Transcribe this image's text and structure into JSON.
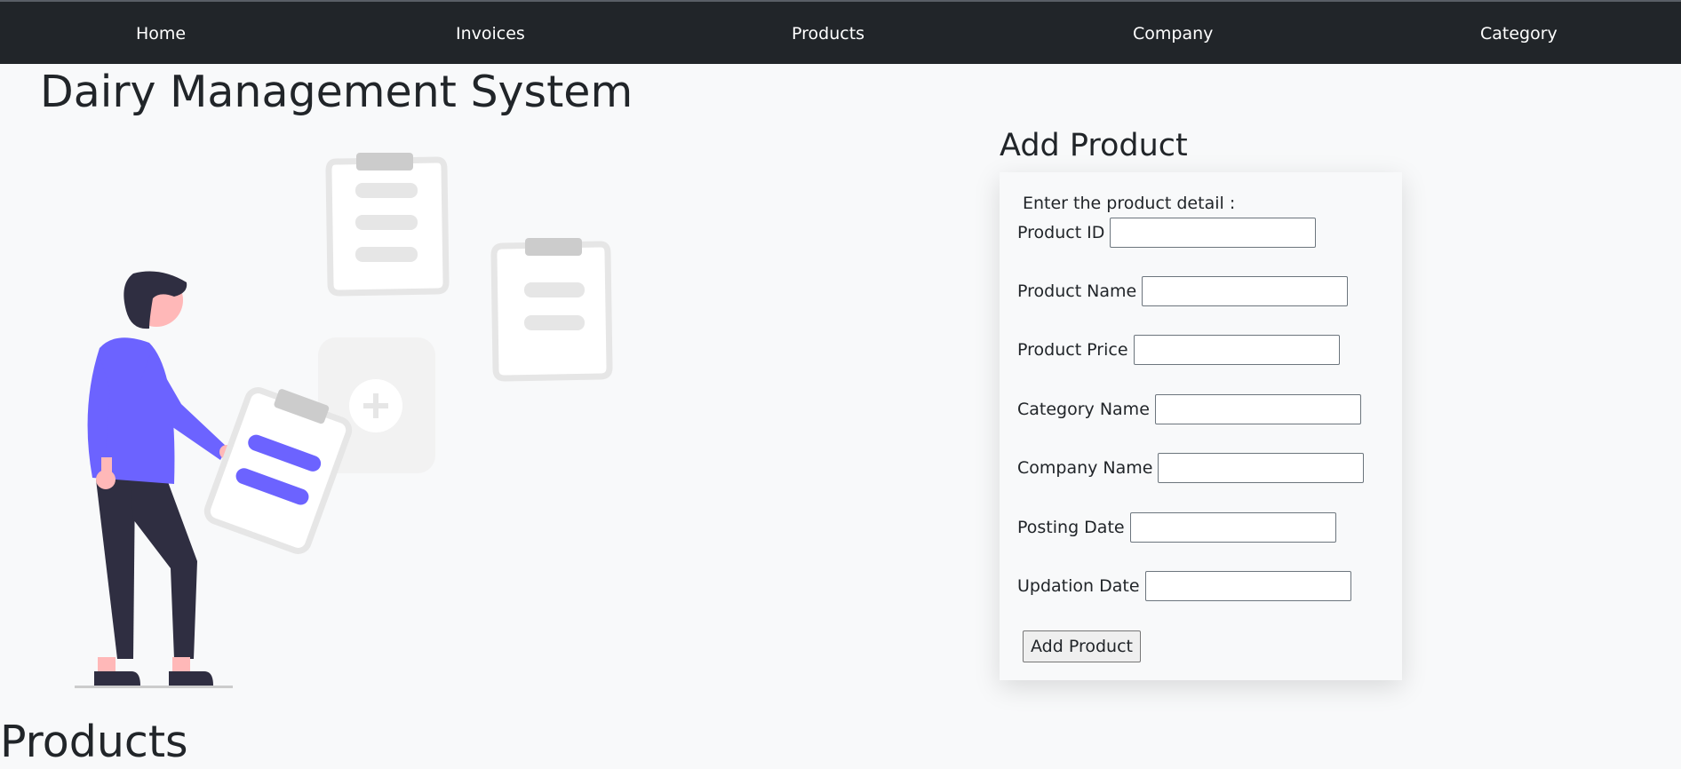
{
  "nav": {
    "items": [
      {
        "label": "Home"
      },
      {
        "label": "Invoices"
      },
      {
        "label": "Products"
      },
      {
        "label": "Company"
      },
      {
        "label": "Category"
      }
    ]
  },
  "page": {
    "title": "Dairy Management System",
    "section_title": "Products"
  },
  "illustration": {
    "icon": "person-with-clipboards-illustration",
    "accent_color": "#6c63ff"
  },
  "form": {
    "heading": "Add Product",
    "intro": "Enter the product detail :",
    "fields": [
      {
        "label": "Product ID",
        "value": ""
      },
      {
        "label": "Product Name",
        "value": ""
      },
      {
        "label": "Product Price",
        "value": ""
      },
      {
        "label": "Category Name",
        "value": ""
      },
      {
        "label": "Company Name",
        "value": ""
      },
      {
        "label": "Posting Date",
        "value": ""
      },
      {
        "label": "Updation Date",
        "value": ""
      }
    ],
    "submit_label": "Add Product"
  },
  "colors": {
    "navbar": "#212529",
    "background": "#f8f9fa"
  }
}
